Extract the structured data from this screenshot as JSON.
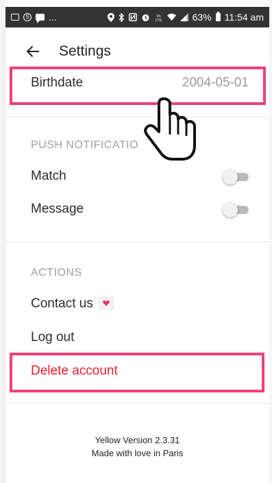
{
  "status_bar": {
    "battery": "63%",
    "time": "11:54 am",
    "more": "..."
  },
  "header": {
    "title": "Settings"
  },
  "profile": {
    "birthdate_label": "Birthdate",
    "birthdate_value": "2004-05-01"
  },
  "push_notifications": {
    "section_label": "PUSH NOTIFICATIO",
    "items": [
      {
        "label": "Match",
        "enabled": false
      },
      {
        "label": "Message",
        "enabled": false
      }
    ]
  },
  "actions": {
    "section_label": "ACTIONS",
    "contact_label": "Contact us",
    "logout_label": "Log out",
    "delete_label": "Delete account"
  },
  "footer": {
    "version": "Yellow Version 2.3.31",
    "tagline": "Made with love in Paris"
  },
  "colors": {
    "highlight": "#f0407a",
    "delete_text": "#e8202a",
    "status_bar": "#333333"
  }
}
